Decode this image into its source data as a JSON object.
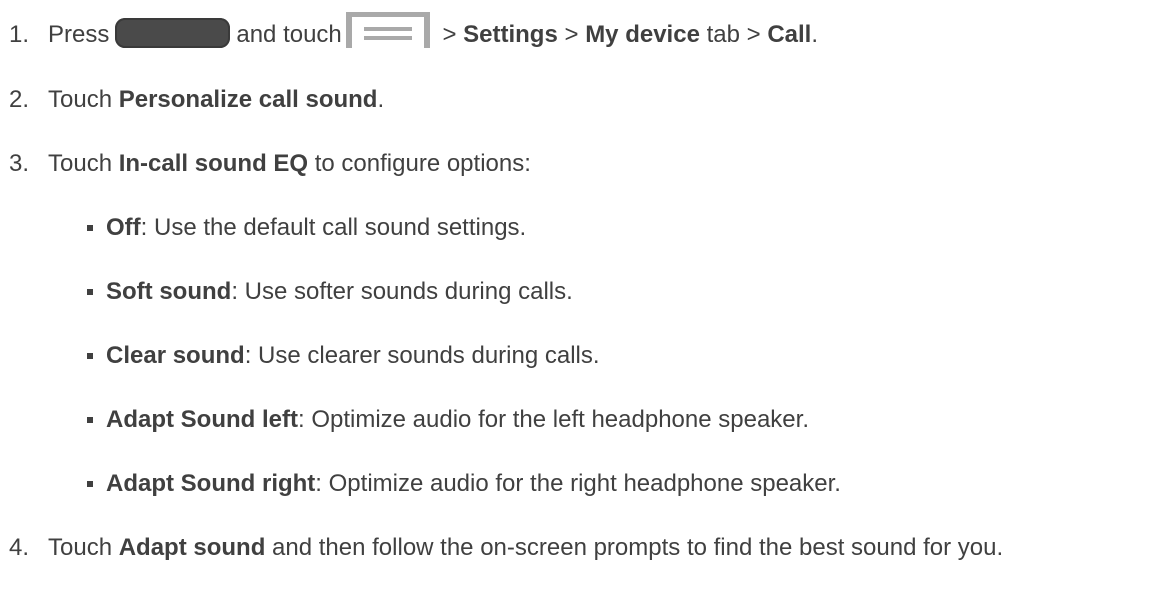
{
  "steps": [
    {
      "num": "1.",
      "press": "Press",
      "and_touch": "and touch",
      "sep1": " > ",
      "settings": "Settings",
      "sep2": " > ",
      "my_device": "My device",
      "tab": " tab > ",
      "call": "Call",
      "period": "."
    },
    {
      "num": "2.",
      "touch": "Touch ",
      "bold": "Personalize call sound",
      "period": "."
    },
    {
      "num": "3.",
      "touch": "Touch ",
      "bold": "In-call sound EQ",
      "rest": " to configure options:"
    },
    {
      "num": "4.",
      "touch": "Touch ",
      "bold": "Adapt sound",
      "rest": " and then follow the on-screen prompts to find the best sound for you."
    }
  ],
  "options": [
    {
      "bold": "Off",
      "rest": ": Use the default call sound settings."
    },
    {
      "bold": "Soft sound",
      "rest": ": Use softer sounds during calls."
    },
    {
      "bold": "Clear sound",
      "rest": ": Use clearer sounds during calls."
    },
    {
      "bold": "Adapt Sound left",
      "rest": ": Optimize audio for the left headphone speaker."
    },
    {
      "bold": "Adapt Sound right",
      "rest": ": Optimize audio for the right headphone speaker."
    }
  ],
  "icons": {
    "home": "home-button-icon",
    "menu": "menu-key-icon"
  },
  "colors": {
    "text": "#404040",
    "home_button": "#4a4a4a",
    "menu_icon": "#a9a9a9"
  }
}
